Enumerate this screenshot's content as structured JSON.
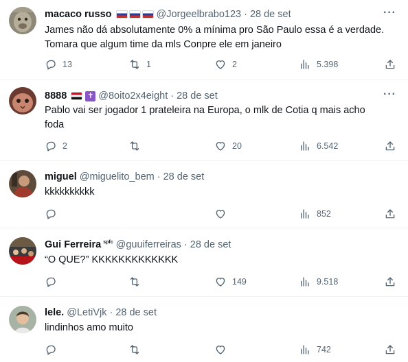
{
  "tweets": [
    {
      "name": "macaco russo",
      "handle": "@Jorgeelbrabo123",
      "dot": "·",
      "date": "28 de set",
      "text_line1": "James não dá absolutamente 0% a mínima pro São Paulo essa é a verdade.",
      "text_line2": "Tomara que algum time da mls Conpre ele em janeiro",
      "replies": "13",
      "retweets": "1",
      "likes": "2",
      "views": "5.398",
      "badges": [
        "flag-russia",
        "flag-russia",
        "flag-russia"
      ]
    },
    {
      "name": "8888",
      "handle": "@8oito2x4eight",
      "dot": "·",
      "date": "28 de set",
      "text_line1": "Pablo vai ser jogador 1 prateleira na Europa, o mlk de Cotia q mais acho",
      "text_line2": "foda",
      "replies": "2",
      "retweets": "",
      "likes": "20",
      "views": "6.542",
      "badges": [
        "flag-egypt",
        "latin-cross"
      ],
      "cross_glyph": "✝"
    },
    {
      "name": "miguel",
      "handle": "@miguelito_bem",
      "dot": "·",
      "date": "28 de set",
      "text_line1": "kkkkkkkkkk",
      "replies": "",
      "likes": "",
      "views": "852"
    },
    {
      "name": "Gui Ferreira",
      "name_badge": "spfc",
      "handle": "@guuiferreiras",
      "dot": "·",
      "date": "28 de set",
      "text_line1": "“O QUE?” KKKKKKKKKKKKK",
      "replies": "",
      "retweets": "",
      "likes": "149",
      "views": "9.518"
    },
    {
      "name": "lele.",
      "handle": "@LetiVjk",
      "dot": "·",
      "date": "28 de set",
      "text_line1": "lindinhos amo muito",
      "replies": "",
      "retweets": "",
      "likes": "",
      "views": "742"
    }
  ],
  "more_glyph": "···",
  "icons": [
    "reply-icon",
    "retweet-icon",
    "like-icon",
    "views-icon",
    "share-icon",
    "more-icon"
  ],
  "colors": {
    "secondary_text": "#536471",
    "primary_text": "#0f1419",
    "divider": "#eff3f4"
  }
}
